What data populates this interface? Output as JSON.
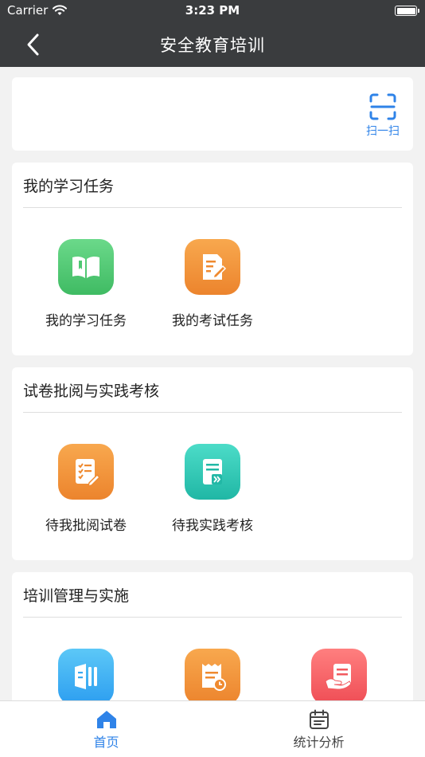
{
  "status_bar": {
    "carrier": "Carrier",
    "time": "3:23 PM"
  },
  "nav": {
    "title": "安全教育培训"
  },
  "scan": {
    "label": "扫一扫"
  },
  "sections": [
    {
      "title": "我的学习任务",
      "items": [
        {
          "label": "我的学习任务",
          "icon": "book-icon"
        },
        {
          "label": "我的考试任务",
          "icon": "exam-edit-icon"
        }
      ]
    },
    {
      "title": "试卷批阅与实践考核",
      "items": [
        {
          "label": "待我批阅试卷",
          "icon": "checklist-icon"
        },
        {
          "label": "待我实践考核",
          "icon": "document-arrow-icon"
        }
      ]
    },
    {
      "title": "培训管理与实施",
      "items": [
        {
          "icon": "courseware-icon"
        },
        {
          "icon": "receipt-clock-icon"
        },
        {
          "icon": "hand-document-icon"
        }
      ]
    }
  ],
  "tabs": [
    {
      "label": "首页",
      "icon": "home-icon",
      "active": true
    },
    {
      "label": "统计分析",
      "icon": "calendar-icon",
      "active": false
    }
  ],
  "colors": {
    "nav_bg": "#3a3c3e",
    "accent": "#2f83e8",
    "page_bg": "#f2f2f2"
  }
}
